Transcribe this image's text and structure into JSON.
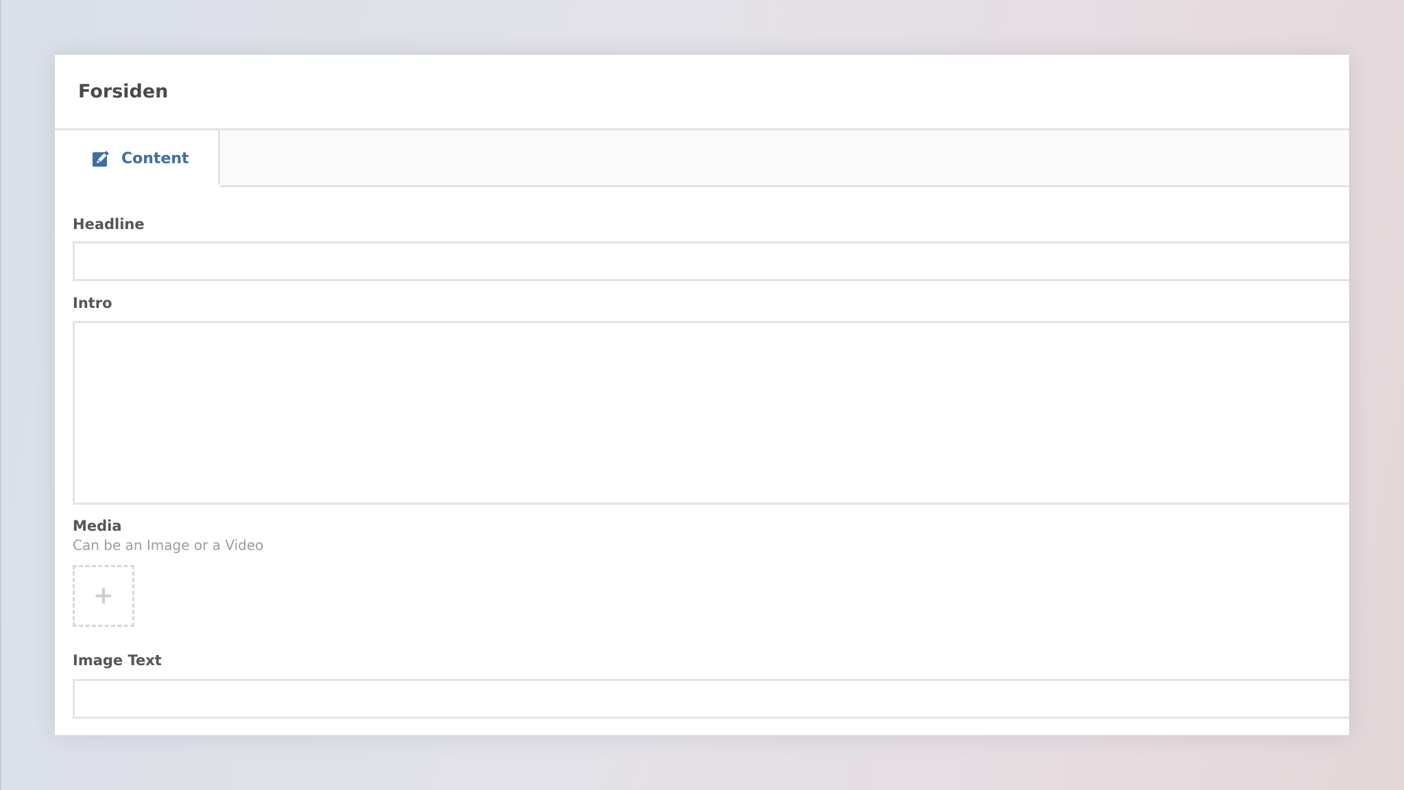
{
  "page": {
    "title": "Forsiden"
  },
  "tabs": [
    {
      "label": "Content",
      "icon": "edit-icon",
      "selected": true
    }
  ],
  "fields": {
    "headline": {
      "label": "Headline",
      "value": ""
    },
    "intro": {
      "label": "Intro",
      "value": ""
    },
    "media": {
      "label": "Media",
      "help": "Can be an Image or a Video",
      "add_symbol": "+"
    },
    "image_text": {
      "label": "Image Text",
      "value": ""
    }
  },
  "colors": {
    "accent": "#3d6ea7",
    "title_text": "#4a4a4a",
    "label_text": "#555555",
    "help_text": "#9c9c9c",
    "border": "#e3e3e3"
  }
}
